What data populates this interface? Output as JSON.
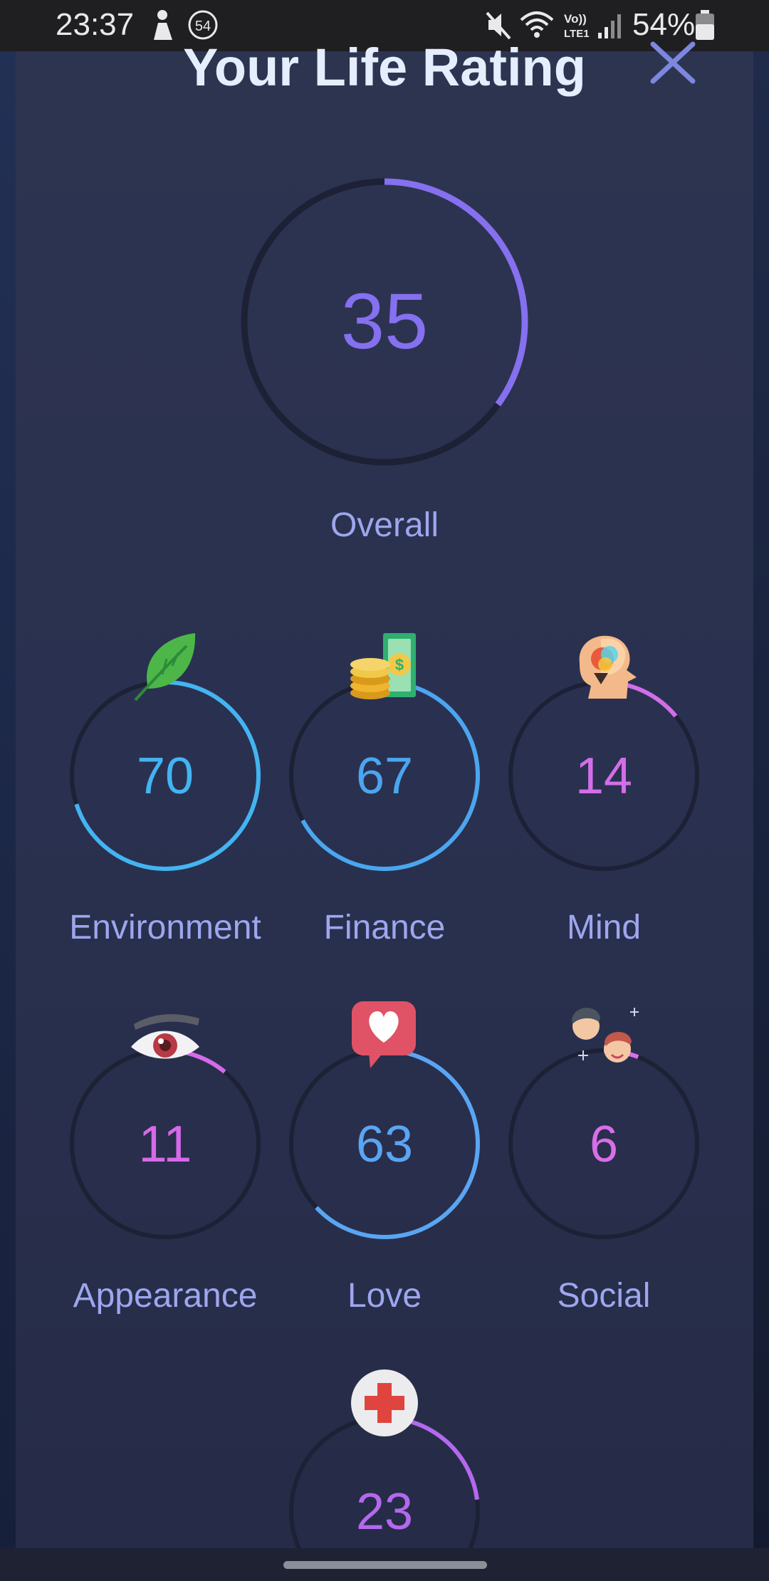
{
  "status_bar": {
    "time": "23:37",
    "notification_count": "54",
    "battery_percent": "54%"
  },
  "header": {
    "title": "Your Life Rating"
  },
  "overall": {
    "value": "35",
    "label": "Overall",
    "fraction": 0.35,
    "color": "#8570f0"
  },
  "categories": [
    {
      "value": "70",
      "label": "Environment",
      "fraction": 0.7,
      "color": "#43b4f2",
      "icon": "leaf-icon"
    },
    {
      "value": "67",
      "label": "Finance",
      "fraction": 0.67,
      "color": "#4aa6ef",
      "icon": "money-icon"
    },
    {
      "value": "14",
      "label": "Mind",
      "fraction": 0.14,
      "color": "#d26ee8",
      "icon": "brain-head-icon"
    },
    {
      "value": "11",
      "label": "Appearance",
      "fraction": 0.11,
      "color": "#d56ae8",
      "icon": "eye-icon"
    },
    {
      "value": "63",
      "label": "Love",
      "fraction": 0.63,
      "color": "#5aa5f3",
      "icon": "heart-bubble-icon"
    },
    {
      "value": "6",
      "label": "Social",
      "fraction": 0.06,
      "color": "#d86ee8",
      "icon": "people-icon"
    },
    {
      "value": "23",
      "label": "",
      "fraction": 0.23,
      "color": "#b468ee",
      "icon": "medical-cross-icon"
    }
  ]
}
